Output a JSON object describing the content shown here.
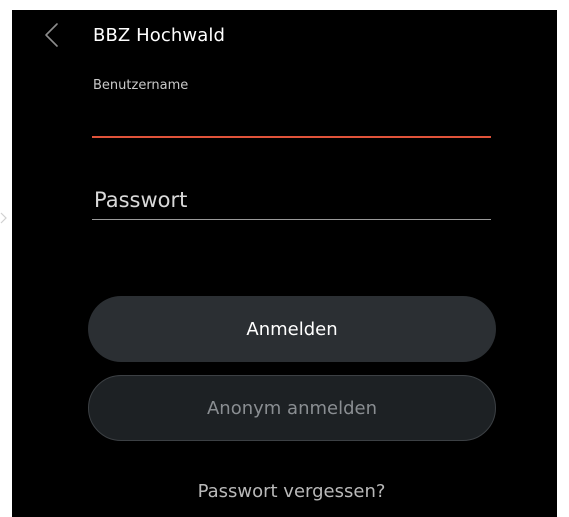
{
  "header": {
    "back_icon": "chevron-left-icon",
    "title": "BBZ Hochwald"
  },
  "form": {
    "username": {
      "label": "Benutzername",
      "value": "",
      "placeholder": ""
    },
    "password": {
      "value": "",
      "placeholder": "Passwort"
    }
  },
  "buttons": {
    "login_label": "Anmelden",
    "anonymous_label": "Anonym anmelden"
  },
  "links": {
    "forgot_password": "Passwort vergessen?"
  },
  "colors": {
    "background": "#000000",
    "accent_underline": "#e0533a",
    "primary_button": "#2b2f33",
    "secondary_button": "#1d2124",
    "text_primary": "#ffffff",
    "text_secondary": "#b9b9b9"
  }
}
